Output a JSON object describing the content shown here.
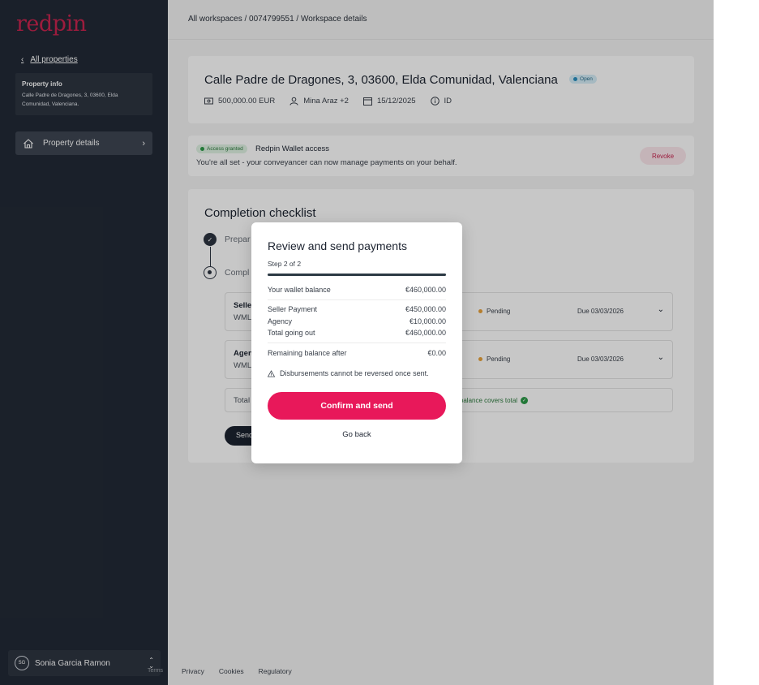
{
  "app": {
    "logo": "redpin",
    "brand_color": "#c8254f",
    "accent_color": "#e8185a"
  },
  "sidebar": {
    "back_label": "All properties",
    "property_info": {
      "title": "Property info",
      "address": "Calle Padre de Dragones, 3, 03600, Elda Comunidad, Valenciana."
    },
    "nav": [
      {
        "label": "Property details",
        "icon": "house-icon",
        "active": true
      }
    ],
    "user": {
      "initials": "SG",
      "name": "Sonia Garcia Ramon"
    }
  },
  "breadcrumb": "All workspaces / 0074799551 / Workspace details",
  "property": {
    "address": "Calle Padre de Dragones, 3, 03600, Elda Comunidad, Valenciana",
    "status": "Open",
    "amount": "500,000.00 EUR",
    "people": "Mina Araz +2",
    "date": "15/12/2025",
    "id_label": "ID"
  },
  "wallet_access": {
    "badge": "Access granted",
    "title": "Redpin Wallet access",
    "subtitle": "You're all set - your conveyancer can now manage payments on your behalf.",
    "revoke_label": "Revoke"
  },
  "checklist": {
    "title": "Completion checklist",
    "steps": [
      {
        "label": "Prepar",
        "done": true
      },
      {
        "label": "Compl",
        "done": false
      }
    ],
    "payments": [
      {
        "name": "Selle",
        "ref": "WML",
        "status": "Pending",
        "due": "Due 03/03/2026"
      },
      {
        "name": "Agen",
        "ref": "WML",
        "status": "Pending",
        "due": "Due 03/03/2026"
      }
    ],
    "total_label": "Total",
    "covers_text": "et balance covers total",
    "send_label": "Send"
  },
  "footer": {
    "faded": "Terms",
    "links": [
      "Privacy",
      "Cookies",
      "Regulatory"
    ]
  },
  "modal": {
    "title": "Review and send payments",
    "step": "Step 2 of 2",
    "progress": 1.0,
    "wallet_balance_label": "Your wallet balance",
    "wallet_balance_value": "€460,000.00",
    "lines": [
      {
        "label": "Seller Payment",
        "value": "€450,000.00"
      },
      {
        "label": "Agency",
        "value": "€10,000.00"
      },
      {
        "label": "Total going out",
        "value": "€460,000.00"
      }
    ],
    "remaining_label": "Remaining balance after",
    "remaining_value": "€0.00",
    "warning": "Disbursements cannot be reversed once sent.",
    "confirm_label": "Confirm and send",
    "back_label": "Go back"
  }
}
